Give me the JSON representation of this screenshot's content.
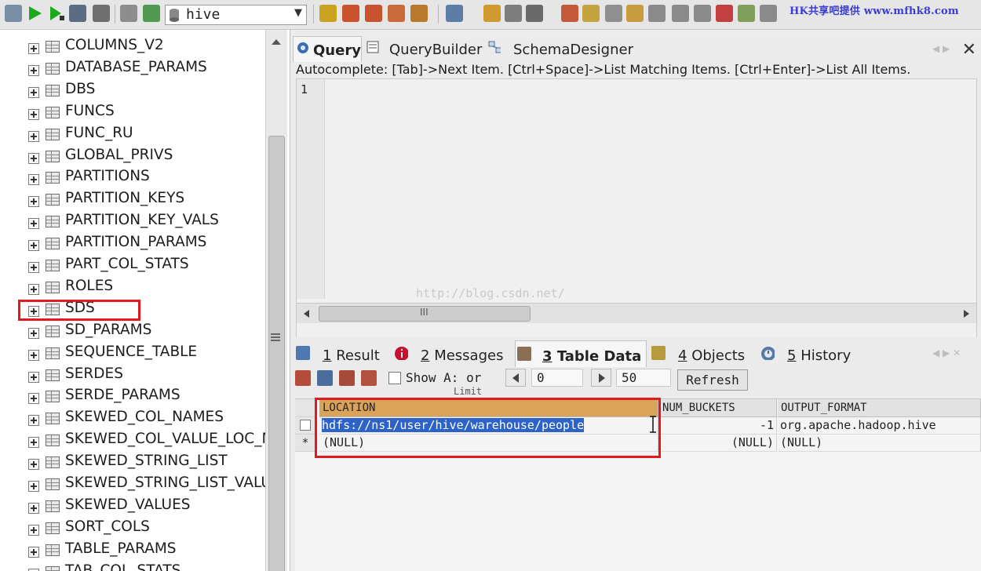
{
  "toolbar": {
    "database": "hive",
    "watermark": "HK共享吧提供 www.mfhk8.com"
  },
  "tree": {
    "items": [
      "COLUMNS_V2",
      "DATABASE_PARAMS",
      "DBS",
      "FUNCS",
      "FUNC_RU",
      "GLOBAL_PRIVS",
      "PARTITIONS",
      "PARTITION_KEYS",
      "PARTITION_KEY_VALS",
      "PARTITION_PARAMS",
      "PART_COL_STATS",
      "ROLES",
      "SDS",
      "SD_PARAMS",
      "SEQUENCE_TABLE",
      "SERDES",
      "SERDE_PARAMS",
      "SKEWED_COL_NAMES",
      "SKEWED_COL_VALUE_LOC_M",
      "SKEWED_STRING_LIST",
      "SKEWED_STRING_LIST_VALU",
      "SKEWED_VALUES",
      "SORT_COLS",
      "TABLE_PARAMS",
      "TAB_COL_STATS"
    ],
    "highlighted": "SDS"
  },
  "query": {
    "tabs": [
      "Query",
      "QueryBuilder",
      "SchemaDesigner"
    ],
    "autocomplete_hint": "Autocomplete: [Tab]->Next Item. [Ctrl+Space]->List Matching Items. [Ctrl+Enter]->List All Items.",
    "line_number": "1",
    "scroll_grip": "III",
    "watermark": "http://blog.csdn.net/"
  },
  "results": {
    "tabs": [
      {
        "num": "1",
        "label": "Result"
      },
      {
        "num": "2",
        "label": "Messages"
      },
      {
        "num": "3",
        "label": "Table Data"
      },
      {
        "num": "4",
        "label": "Objects"
      },
      {
        "num": "5",
        "label": "History"
      }
    ],
    "active_tab": "Table Data",
    "show_label": "Show A: or",
    "limit_label": "Limit",
    "offset": "0",
    "limit": "50",
    "refresh_label": "Refresh",
    "columns": [
      "LOCATION",
      "NUM_BUCKETS",
      "OUTPUT_FORMAT"
    ],
    "rows": [
      {
        "location": "hdfs://ns1/user/hive/warehouse/people",
        "num_buckets": "-1",
        "output_format": "org.apache.hadoop.hive"
      },
      {
        "marker": "*",
        "location": "(NULL)",
        "num_buckets": "(NULL)",
        "output_format": "(NULL)"
      }
    ]
  },
  "colors": {
    "highlight_box": "#e01b1b",
    "selected_header": "#d9a35a",
    "selection": "#2d63c8"
  }
}
